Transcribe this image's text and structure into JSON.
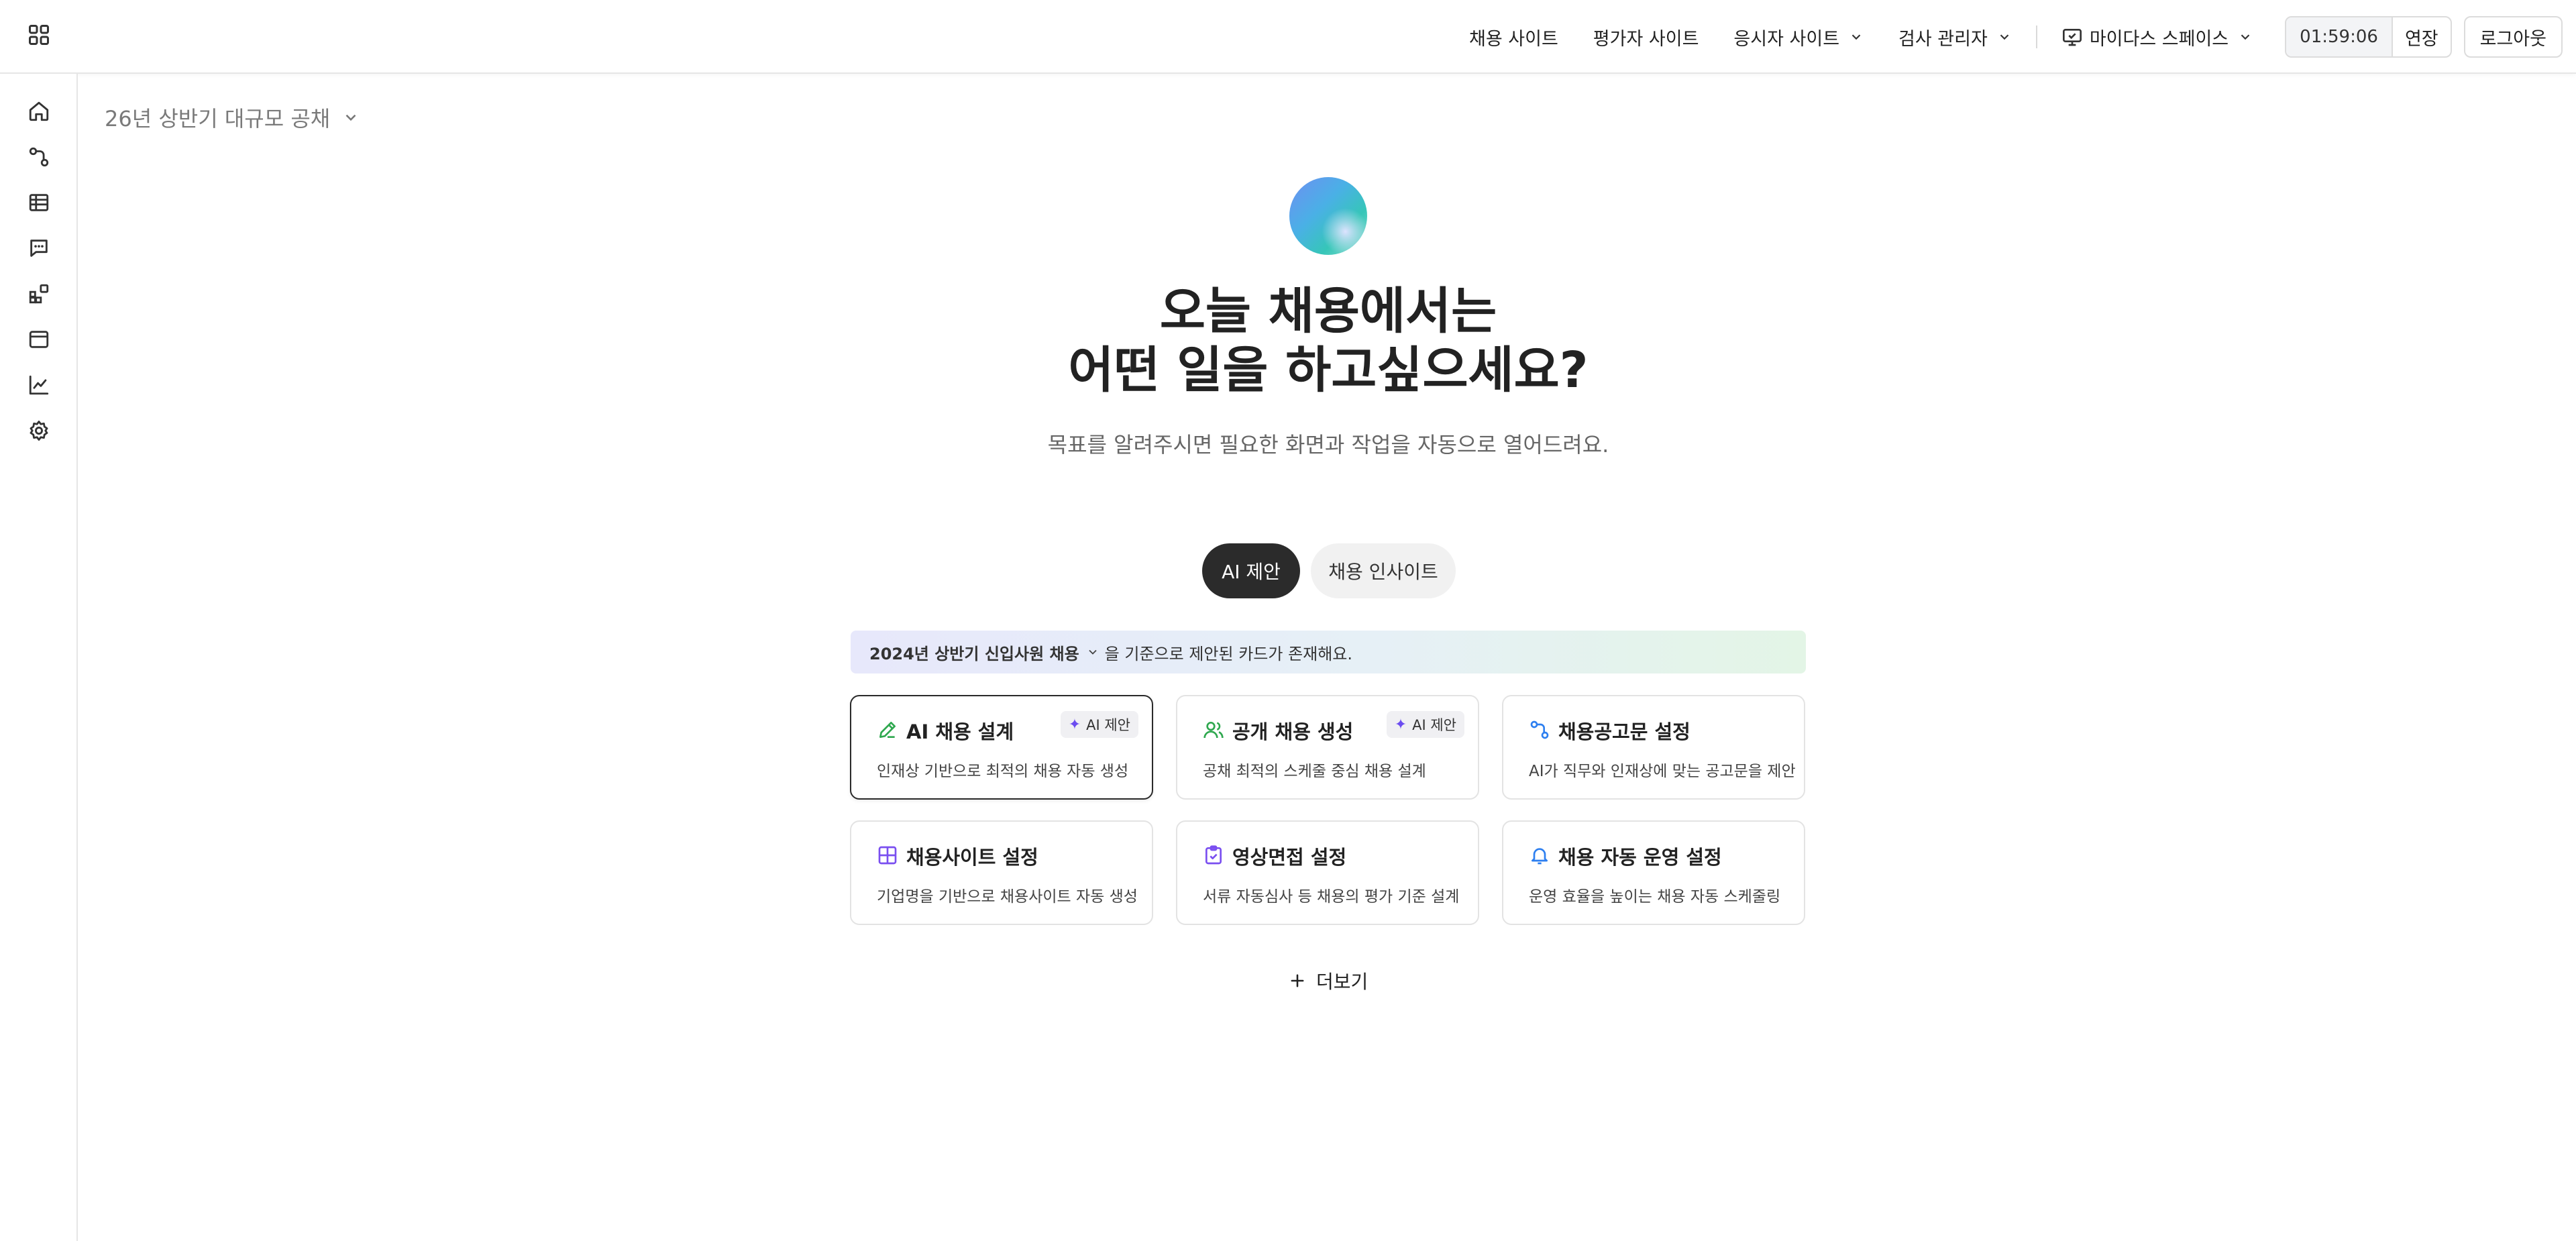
{
  "header": {
    "nav": {
      "hiring_site": "채용 사이트",
      "evaluator_site": "평가자 사이트",
      "applicant_site": "응시자 사이트",
      "exam_admin": "검사 관리자",
      "workspace_menu": "마이다스 스페이스"
    },
    "session_timer": "01:59:06",
    "extend_label": "연장",
    "logout_label": "로그아웃"
  },
  "sidebar": {
    "icons": [
      "home-icon",
      "workflow-icon",
      "table-icon",
      "message-icon",
      "apps-add-icon",
      "window-icon",
      "chart-line-icon",
      "settings-icon"
    ]
  },
  "main": {
    "workspace_selector": "26년 상반기 대규모 공채",
    "headline_line1": "오늘 채용에서는",
    "headline_line2": "어떤 일을 하고싶으세요?",
    "subtitle": "목표를 알려주시면 필요한 화면과 작업을 자동으로 열어드려요.",
    "tabs": [
      {
        "label": "AI 제안",
        "active": true
      },
      {
        "label": "채용 인사이트",
        "active": false
      }
    ],
    "banner": {
      "selection": "2024년 상반기 신입사원 채용",
      "suffix": "을 기준으로 제안된 카드가 존재해요."
    },
    "cards": [
      {
        "title": "AI 채용 설계",
        "desc": "인재상 기반으로 최적의 채용 자동 생성",
        "badge": "AI 제안",
        "icon": "pencil-icon"
      },
      {
        "title": "공개 채용 생성",
        "desc": "공채 최적의 스케줄 중심 채용 설계",
        "badge": "AI 제안",
        "icon": "users-icon"
      },
      {
        "title": "채용공고문 설정",
        "desc": "AI가 직무와 인재상에 맞는 공고문을 제안",
        "icon": "route-icon"
      },
      {
        "title": "채용사이트 설정",
        "desc": "기업명을 기반으로 채용사이트 자동 생성",
        "icon": "layout-icon"
      },
      {
        "title": "영상면접 설정",
        "desc": "서류 자동심사 등 채용의 평가 기준 설계",
        "icon": "clipboard-check-icon"
      },
      {
        "title": "채용 자동 운영 설정",
        "desc": "운영 효율을 높이는 채용 자동 스케줄링",
        "icon": "bell-icon"
      }
    ],
    "more_label": "더보기"
  },
  "colors": {
    "primary_dark": "#2b2b2b",
    "accent_purple": "#6b4cf0",
    "icon_green": "#2fa84f",
    "icon_blue": "#2d7ff0",
    "icon_violet": "#7a4ff0"
  }
}
